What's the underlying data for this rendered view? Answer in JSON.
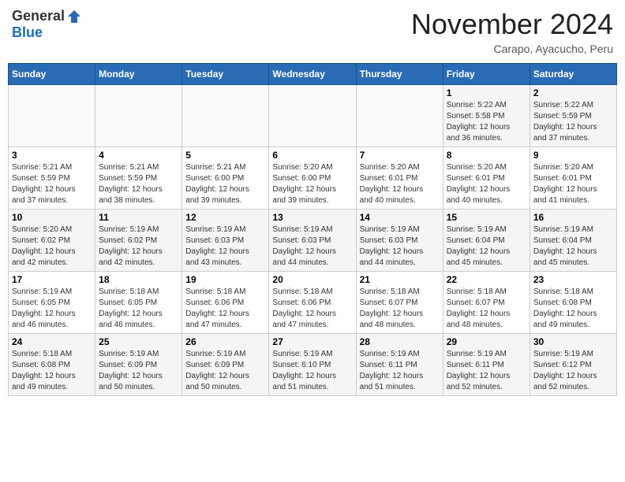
{
  "header": {
    "logo_general": "General",
    "logo_blue": "Blue",
    "month_title": "November 2024",
    "location": "Carapo, Ayacucho, Peru"
  },
  "calendar": {
    "days_of_week": [
      "Sunday",
      "Monday",
      "Tuesday",
      "Wednesday",
      "Thursday",
      "Friday",
      "Saturday"
    ],
    "weeks": [
      [
        {
          "day": "",
          "info": ""
        },
        {
          "day": "",
          "info": ""
        },
        {
          "day": "",
          "info": ""
        },
        {
          "day": "",
          "info": ""
        },
        {
          "day": "",
          "info": ""
        },
        {
          "day": "1",
          "info": "Sunrise: 5:22 AM\nSunset: 5:58 PM\nDaylight: 12 hours\nand 36 minutes."
        },
        {
          "day": "2",
          "info": "Sunrise: 5:22 AM\nSunset: 5:59 PM\nDaylight: 12 hours\nand 37 minutes."
        }
      ],
      [
        {
          "day": "3",
          "info": "Sunrise: 5:21 AM\nSunset: 5:59 PM\nDaylight: 12 hours\nand 37 minutes."
        },
        {
          "day": "4",
          "info": "Sunrise: 5:21 AM\nSunset: 5:59 PM\nDaylight: 12 hours\nand 38 minutes."
        },
        {
          "day": "5",
          "info": "Sunrise: 5:21 AM\nSunset: 6:00 PM\nDaylight: 12 hours\nand 39 minutes."
        },
        {
          "day": "6",
          "info": "Sunrise: 5:20 AM\nSunset: 6:00 PM\nDaylight: 12 hours\nand 39 minutes."
        },
        {
          "day": "7",
          "info": "Sunrise: 5:20 AM\nSunset: 6:01 PM\nDaylight: 12 hours\nand 40 minutes."
        },
        {
          "day": "8",
          "info": "Sunrise: 5:20 AM\nSunset: 6:01 PM\nDaylight: 12 hours\nand 40 minutes."
        },
        {
          "day": "9",
          "info": "Sunrise: 5:20 AM\nSunset: 6:01 PM\nDaylight: 12 hours\nand 41 minutes."
        }
      ],
      [
        {
          "day": "10",
          "info": "Sunrise: 5:20 AM\nSunset: 6:02 PM\nDaylight: 12 hours\nand 42 minutes."
        },
        {
          "day": "11",
          "info": "Sunrise: 5:19 AM\nSunset: 6:02 PM\nDaylight: 12 hours\nand 42 minutes."
        },
        {
          "day": "12",
          "info": "Sunrise: 5:19 AM\nSunset: 6:03 PM\nDaylight: 12 hours\nand 43 minutes."
        },
        {
          "day": "13",
          "info": "Sunrise: 5:19 AM\nSunset: 6:03 PM\nDaylight: 12 hours\nand 44 minutes."
        },
        {
          "day": "14",
          "info": "Sunrise: 5:19 AM\nSunset: 6:03 PM\nDaylight: 12 hours\nand 44 minutes."
        },
        {
          "day": "15",
          "info": "Sunrise: 5:19 AM\nSunset: 6:04 PM\nDaylight: 12 hours\nand 45 minutes."
        },
        {
          "day": "16",
          "info": "Sunrise: 5:19 AM\nSunset: 6:04 PM\nDaylight: 12 hours\nand 45 minutes."
        }
      ],
      [
        {
          "day": "17",
          "info": "Sunrise: 5:19 AM\nSunset: 6:05 PM\nDaylight: 12 hours\nand 46 minutes."
        },
        {
          "day": "18",
          "info": "Sunrise: 5:18 AM\nSunset: 6:05 PM\nDaylight: 12 hours\nand 46 minutes."
        },
        {
          "day": "19",
          "info": "Sunrise: 5:18 AM\nSunset: 6:06 PM\nDaylight: 12 hours\nand 47 minutes."
        },
        {
          "day": "20",
          "info": "Sunrise: 5:18 AM\nSunset: 6:06 PM\nDaylight: 12 hours\nand 47 minutes."
        },
        {
          "day": "21",
          "info": "Sunrise: 5:18 AM\nSunset: 6:07 PM\nDaylight: 12 hours\nand 48 minutes."
        },
        {
          "day": "22",
          "info": "Sunrise: 5:18 AM\nSunset: 6:07 PM\nDaylight: 12 hours\nand 48 minutes."
        },
        {
          "day": "23",
          "info": "Sunrise: 5:18 AM\nSunset: 6:08 PM\nDaylight: 12 hours\nand 49 minutes."
        }
      ],
      [
        {
          "day": "24",
          "info": "Sunrise: 5:18 AM\nSunset: 6:08 PM\nDaylight: 12 hours\nand 49 minutes."
        },
        {
          "day": "25",
          "info": "Sunrise: 5:19 AM\nSunset: 6:09 PM\nDaylight: 12 hours\nand 50 minutes."
        },
        {
          "day": "26",
          "info": "Sunrise: 5:19 AM\nSunset: 6:09 PM\nDaylight: 12 hours\nand 50 minutes."
        },
        {
          "day": "27",
          "info": "Sunrise: 5:19 AM\nSunset: 6:10 PM\nDaylight: 12 hours\nand 51 minutes."
        },
        {
          "day": "28",
          "info": "Sunrise: 5:19 AM\nSunset: 6:11 PM\nDaylight: 12 hours\nand 51 minutes."
        },
        {
          "day": "29",
          "info": "Sunrise: 5:19 AM\nSunset: 6:11 PM\nDaylight: 12 hours\nand 52 minutes."
        },
        {
          "day": "30",
          "info": "Sunrise: 5:19 AM\nSunset: 6:12 PM\nDaylight: 12 hours\nand 52 minutes."
        }
      ]
    ]
  }
}
